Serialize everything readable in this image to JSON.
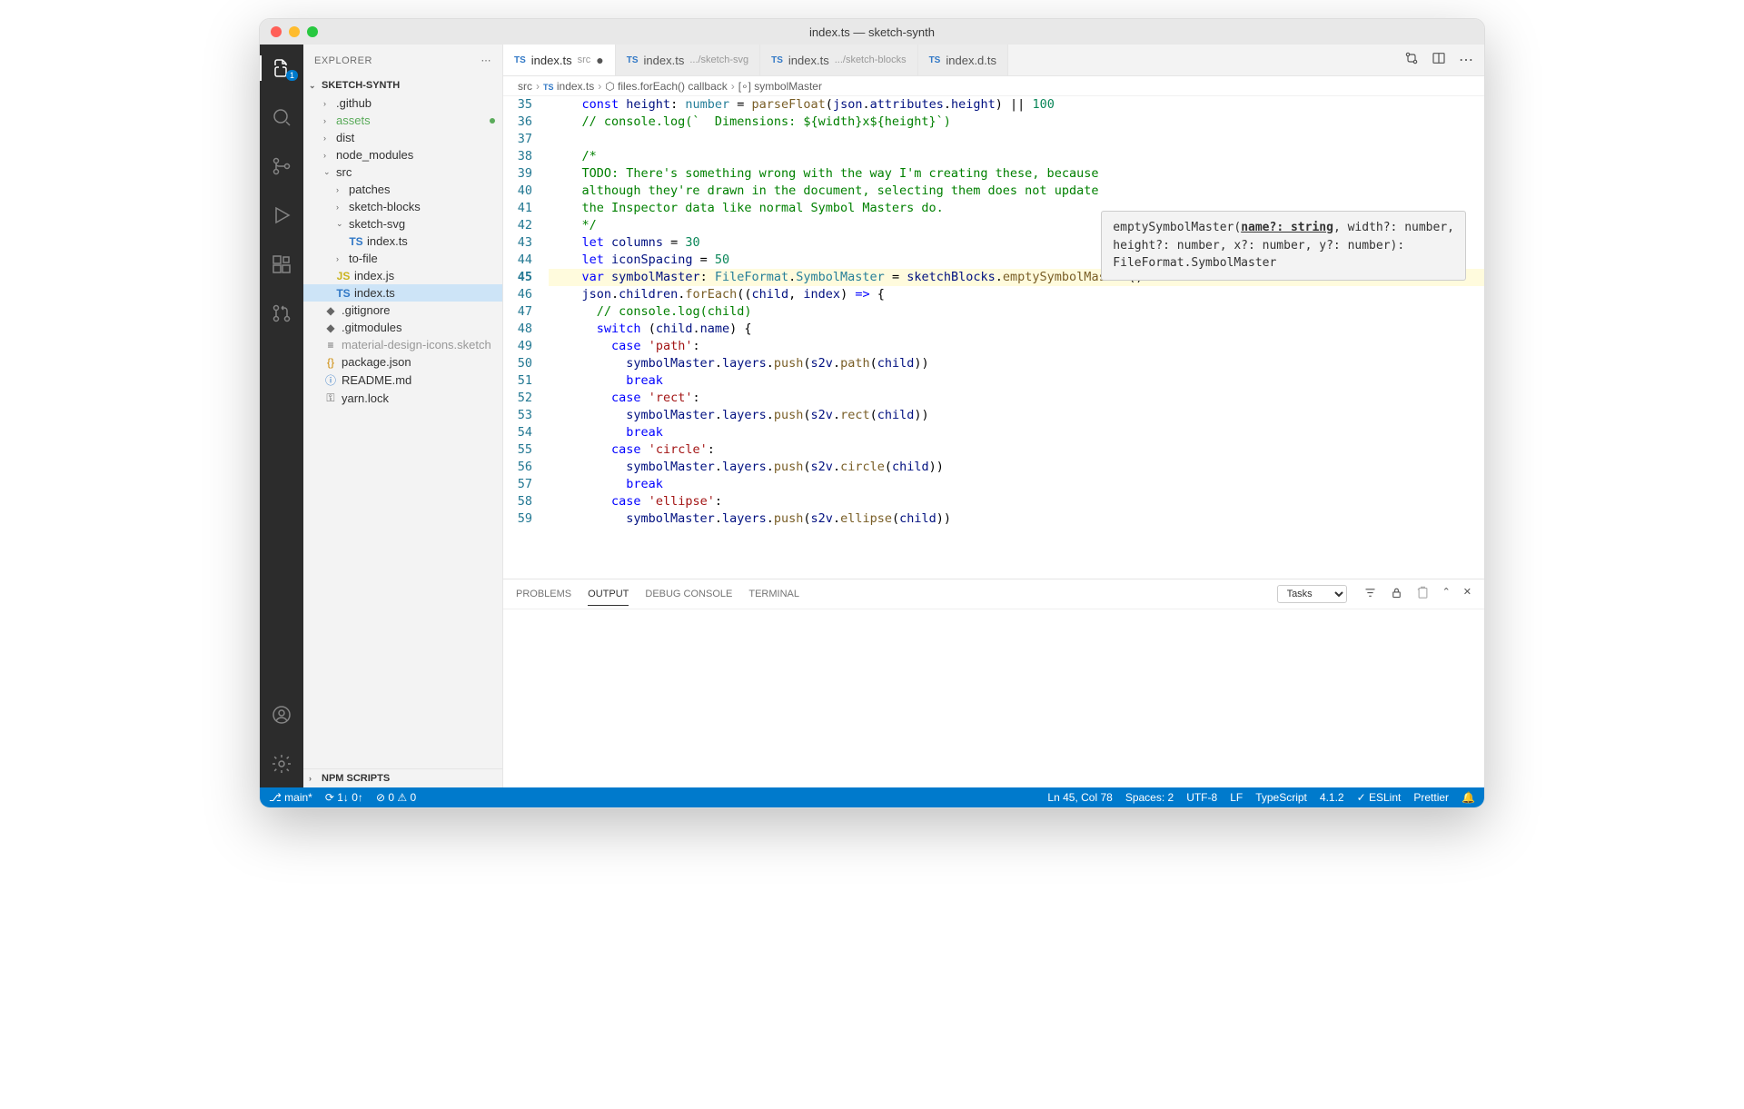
{
  "window_title": "index.ts — sketch-synth",
  "activitybar_badge": "1",
  "sidebar": {
    "title": "EXPLORER",
    "project": "SKETCH-SYNTH",
    "tree": [
      {
        "label": ".github",
        "kind": "folder",
        "depth": 1,
        "expanded": false
      },
      {
        "label": "assets",
        "kind": "folder",
        "depth": 1,
        "expanded": false,
        "dirty": true,
        "accent": "#5aab5a"
      },
      {
        "label": "dist",
        "kind": "folder",
        "depth": 1,
        "expanded": false
      },
      {
        "label": "node_modules",
        "kind": "folder",
        "depth": 1,
        "expanded": false
      },
      {
        "label": "src",
        "kind": "folder",
        "depth": 1,
        "expanded": true
      },
      {
        "label": "patches",
        "kind": "folder",
        "depth": 2,
        "expanded": false
      },
      {
        "label": "sketch-blocks",
        "kind": "folder",
        "depth": 2,
        "expanded": false
      },
      {
        "label": "sketch-svg",
        "kind": "folder",
        "depth": 2,
        "expanded": true
      },
      {
        "label": "index.ts",
        "kind": "ts",
        "depth": 3
      },
      {
        "label": "to-file",
        "kind": "folder",
        "depth": 2,
        "expanded": false
      },
      {
        "label": "index.js",
        "kind": "js",
        "depth": 2
      },
      {
        "label": "index.ts",
        "kind": "ts",
        "depth": 2,
        "selected": true
      },
      {
        "label": ".gitignore",
        "kind": "file",
        "depth": 1,
        "icon": "◆"
      },
      {
        "label": ".gitmodules",
        "kind": "file",
        "depth": 1,
        "icon": "◆"
      },
      {
        "label": "material-design-icons.sketch",
        "kind": "file",
        "depth": 1,
        "icon": "≡",
        "dim": true
      },
      {
        "label": "package.json",
        "kind": "file",
        "depth": 1,
        "icon": "{}",
        "iconColor": "#c80"
      },
      {
        "label": "README.md",
        "kind": "file",
        "depth": 1,
        "icon": "ⓘ",
        "iconColor": "#3178c6"
      },
      {
        "label": "yarn.lock",
        "kind": "file",
        "depth": 1,
        "icon": "⚿"
      }
    ],
    "npm_scripts": "NPM SCRIPTS"
  },
  "tabs": [
    {
      "label": "index.ts",
      "detail": "src",
      "icon": "TS",
      "dirty": true,
      "active": true
    },
    {
      "label": "index.ts",
      "detail": ".../sketch-svg",
      "icon": "TS"
    },
    {
      "label": "index.ts",
      "detail": ".../sketch-blocks",
      "icon": "TS"
    },
    {
      "label": "index.d.ts",
      "detail": "",
      "icon": "TS"
    }
  ],
  "breadcrumb": [
    "src",
    "index.ts",
    "files.forEach() callback",
    "symbolMaster"
  ],
  "tooltip": "emptySymbolMaster(name?: string, width?: number, height?: number, x?: number, y?: number): FileFormat.SymbolMaster",
  "code": {
    "start": 35,
    "highlight": 45,
    "lines": [
      {
        "html": "    <span class='c-kw'>const</span> <span class='c-var'>height</span>: <span class='c-type'>number</span> = <span class='c-fn'>parseFloat</span>(<span class='c-var'>json</span>.<span class='c-prop'>attributes</span>.<span class='c-prop'>height</span>) || <span class='c-num'>100</span>"
      },
      {
        "html": "    <span class='c-comment'>// console.log(`  Dimensions: ${width}x${height}`)</span>"
      },
      {
        "html": ""
      },
      {
        "html": "    <span class='c-comment'>/*</span>"
      },
      {
        "html": "    <span class='c-comment'>TODO: There's something wrong with the way I'm creating these, because</span>"
      },
      {
        "html": "    <span class='c-comment'>although they're drawn in the document, selecting them does not update</span>"
      },
      {
        "html": "    <span class='c-comment'>the Inspector data like normal Symbol Masters do.</span>"
      },
      {
        "html": "    <span class='c-comment'>*/</span>"
      },
      {
        "html": "    <span class='c-kw'>let</span> <span class='c-var'>columns</span> = <span class='c-num'>30</span>"
      },
      {
        "html": "    <span class='c-kw'>let</span> <span class='c-var'>iconSpacing</span> = <span class='c-num'>50</span>"
      },
      {
        "html": "    <span class='c-kw'>var</span> <span class='c-var'>symbolMaster</span>: <span class='c-type'>FileFormat</span>.<span class='c-type'>SymbolMaster</span> = <span class='c-var'>sketchBlocks</span>.<span class='c-fn'>emptySymbolMaster</span>()"
      },
      {
        "html": "    <span class='c-var'>json</span>.<span class='c-prop'>children</span>.<span class='c-fn'>forEach</span>((<span class='c-var'>child</span>, <span class='c-var'>index</span>) <span class='c-kw'>=&gt;</span> {"
      },
      {
        "html": "      <span class='c-comment'>// console.log(child)</span>"
      },
      {
        "html": "      <span class='c-kw'>switch</span> (<span class='c-var'>child</span>.<span class='c-prop'>name</span>) {"
      },
      {
        "html": "        <span class='c-kw'>case</span> <span class='c-str'>'path'</span>:"
      },
      {
        "html": "          <span class='c-var'>symbolMaster</span>.<span class='c-prop'>layers</span>.<span class='c-fn'>push</span>(<span class='c-var'>s2v</span>.<span class='c-fn'>path</span>(<span class='c-var'>child</span>))"
      },
      {
        "html": "          <span class='c-kw'>break</span>"
      },
      {
        "html": "        <span class='c-kw'>case</span> <span class='c-str'>'rect'</span>:"
      },
      {
        "html": "          <span class='c-var'>symbolMaster</span>.<span class='c-prop'>layers</span>.<span class='c-fn'>push</span>(<span class='c-var'>s2v</span>.<span class='c-fn'>rect</span>(<span class='c-var'>child</span>))"
      },
      {
        "html": "          <span class='c-kw'>break</span>"
      },
      {
        "html": "        <span class='c-kw'>case</span> <span class='c-str'>'circle'</span>:"
      },
      {
        "html": "          <span class='c-var'>symbolMaster</span>.<span class='c-prop'>layers</span>.<span class='c-fn'>push</span>(<span class='c-var'>s2v</span>.<span class='c-fn'>circle</span>(<span class='c-var'>child</span>))"
      },
      {
        "html": "          <span class='c-kw'>break</span>"
      },
      {
        "html": "        <span class='c-kw'>case</span> <span class='c-str'>'ellipse'</span>:"
      },
      {
        "html": "          <span class='c-var'>symbolMaster</span>.<span class='c-prop'>layers</span>.<span class='c-fn'>push</span>(<span class='c-var'>s2v</span>.<span class='c-fn'>ellipse</span>(<span class='c-var'>child</span>))"
      }
    ]
  },
  "panel": {
    "tabs": [
      "PROBLEMS",
      "OUTPUT",
      "DEBUG CONSOLE",
      "TERMINAL"
    ],
    "active": 1,
    "select": "Tasks"
  },
  "status": {
    "branch": "main*",
    "sync": "1↓ 0↑",
    "errors": "0",
    "warnings": "0",
    "cursor": "Ln 45, Col 78",
    "spaces": "Spaces: 2",
    "encoding": "UTF-8",
    "eol": "LF",
    "lang": "TypeScript",
    "tsver": "4.1.2",
    "eslint": "ESLint",
    "prettier": "Prettier"
  }
}
